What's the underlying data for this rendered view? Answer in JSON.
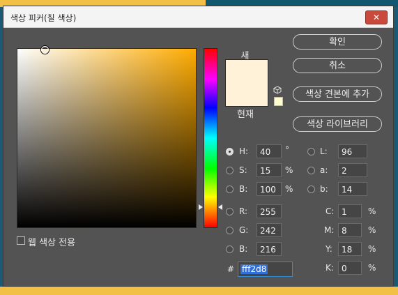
{
  "window": {
    "title": "색상 피커(칠 색상)",
    "close_icon": "✕"
  },
  "colors": {
    "current": "#fff2d8",
    "hue_base": "#ffab00",
    "gamut_swatch": "#fffcd0"
  },
  "preview": {
    "new_label": "새",
    "current_label": "현재"
  },
  "buttons": {
    "ok": "확인",
    "cancel": "취소",
    "add_to_swatches": "색상 견본에 추가",
    "color_libraries": "색상 라이브러리"
  },
  "hsb": {
    "h_label": "H:",
    "h_value": "40",
    "h_unit": "°",
    "s_label": "S:",
    "s_value": "15",
    "s_unit": "%",
    "b_label": "B:",
    "b_value": "100",
    "b_unit": "%"
  },
  "rgb": {
    "r_label": "R:",
    "r_value": "255",
    "g_label": "G:",
    "g_value": "242",
    "b_label": "B:",
    "b_value": "216"
  },
  "lab": {
    "l_label": "L:",
    "l_value": "96",
    "a_label": "a:",
    "a_value": "2",
    "b_label": "b:",
    "b_value": "14"
  },
  "cmyk": {
    "c_label": "C:",
    "c_value": "1",
    "c_unit": "%",
    "m_label": "M:",
    "m_value": "8",
    "m_unit": "%",
    "y_label": "Y:",
    "y_value": "18",
    "y_unit": "%",
    "k_label": "K:",
    "k_value": "0",
    "k_unit": "%"
  },
  "hex": {
    "label": "#",
    "value": "fff2d8"
  },
  "options": {
    "web_colors_only": "웹 색상 전용"
  }
}
